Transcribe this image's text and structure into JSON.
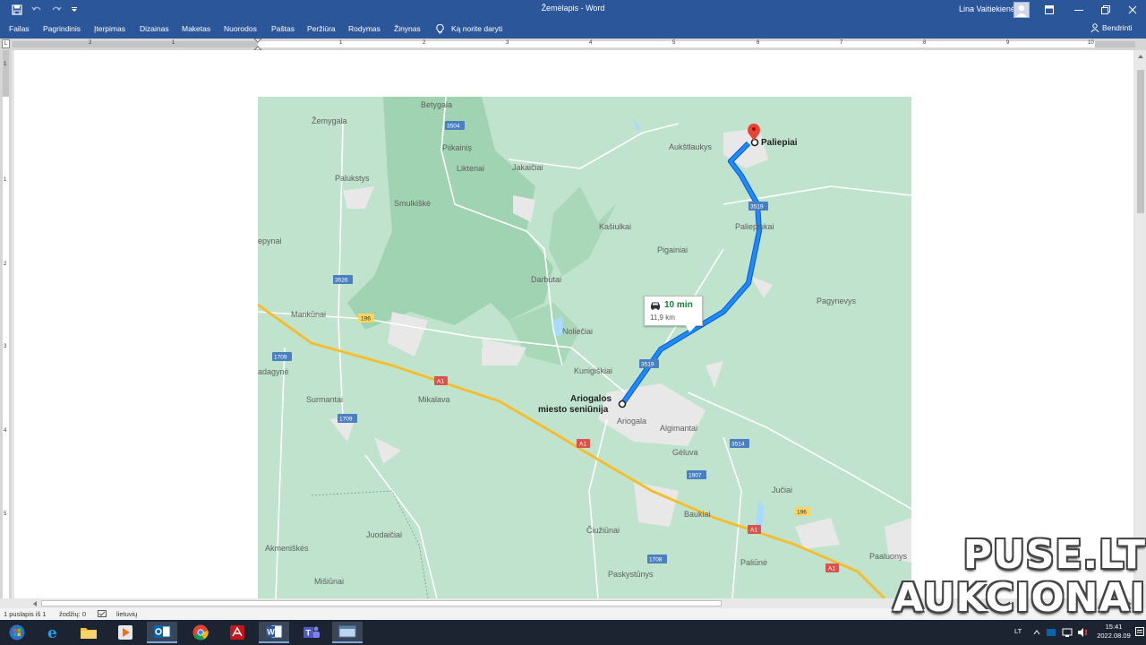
{
  "window": {
    "title": "Žemėlapis - Word",
    "user_name": "Lina Vaitiekienė"
  },
  "ribbon": {
    "tabs": [
      "Failas",
      "Pagrindinis",
      "Įterpimas",
      "Dizainas",
      "Maketas",
      "Nuorodos",
      "Paštas",
      "Peržiūra",
      "Rodymas",
      "Žinynas"
    ],
    "tell_me": "Ką norite daryti",
    "share": "Bendrinti"
  },
  "ruler": {
    "corner": "L",
    "h_numbers": [
      "2",
      "1",
      "1",
      "2",
      "3",
      "4",
      "5",
      "6",
      "7",
      "8",
      "9",
      "10"
    ],
    "v_numbers": [
      "1",
      "1",
      "2",
      "3",
      "4",
      "5"
    ]
  },
  "map": {
    "places": [
      "Betygala",
      "Žemygala",
      "Piikainiș",
      "Liktenai",
      "Jakaičiai",
      "Palukstys",
      "Aukštlaukys",
      "Smulkiškė",
      "Kašiulkai",
      "Paliepiukai",
      "Pigainiai",
      "epynai",
      "Darbutai",
      "Pagynevys",
      "Mankūnai",
      "Noliečiai",
      "Kunigiškiai",
      "adagynė",
      "Surmantai",
      "Mikalava",
      "Ariogala",
      "Algimantai",
      "Gėluva",
      "Jučiai",
      "Baukiai",
      "Akmeniškės",
      "Juodaičiai",
      "Čiužiūnai",
      "Paskystūnys",
      "Paliūnė",
      "Paaluonys",
      "Mišiūnai"
    ],
    "destination": "Paliepiai",
    "origin_line1": "Ariogalos",
    "origin_line2": "miesto seniūnija",
    "road_numbers": [
      "3504",
      "3519",
      "3526",
      "196",
      "1709",
      "3519",
      "A1",
      "1709",
      "A1",
      "3514",
      "1907",
      "196",
      "A1",
      "1708",
      "A1"
    ],
    "route": {
      "time": "10 min",
      "distance": "11,9 km"
    }
  },
  "statusbar": {
    "page": "1 puslapis iš 1",
    "words": "žodžių: 0",
    "language": "lietuvių"
  },
  "taskbar": {
    "lang": "LT",
    "time": "15:41",
    "date": "2022.08.09",
    "apps": [
      "start-icon",
      "internet-explorer-icon",
      "file-explorer-icon",
      "media-player-icon",
      "outlook-icon",
      "chrome-icon",
      "acrobat-icon",
      "word-icon",
      "teams-icon",
      "window-icon"
    ]
  },
  "watermark": {
    "line1": "PUSE.LT",
    "line2": "AUKCIONAI"
  },
  "colors": {
    "word_blue": "#2b579a",
    "map_green": "#bfe3cc",
    "map_forest": "#9fd3b1",
    "route_blue": "#1a73e8",
    "motorway": "#f4c542",
    "time_green": "#188038"
  }
}
